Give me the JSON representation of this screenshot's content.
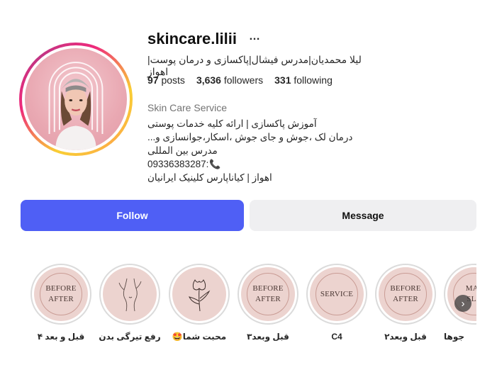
{
  "profile": {
    "username": "skincare.lilii",
    "more_icon": "…",
    "full_name": "لیلا محمدیان|مدرس فیشال|پاکسازی و درمان پوست|اهواز",
    "stats": {
      "posts_count": "97",
      "posts_label": "posts",
      "followers_count": "3,636",
      "followers_label": "followers",
      "following_count": "331",
      "following_label": "following"
    },
    "category": "Skin Care Service",
    "bio": {
      "line1": "آموزش پاکسازی | ارائه کلیه خدمات پوستی",
      "line2": "درمان لک ،جوش و جای جوش ،اسکار،جوانسازی و...",
      "line3": "مدرس بین المللی",
      "phone": "09336383287:",
      "phone_icon": "📞",
      "line5": "اهواز | کیاناپارس کلینیک ایرانیان"
    }
  },
  "actions": {
    "follow_label": "Follow",
    "message_label": "Message"
  },
  "highlights": [
    {
      "label": "قبل و بعد ۴",
      "text_line1": "BEFORE",
      "text_line2": "AFTER",
      "type": "text"
    },
    {
      "label": "رفع تیرگی بدن",
      "type": "body-sketch-icon"
    },
    {
      "label": "محبت شما🤩",
      "type": "flower-icon"
    },
    {
      "label": "قبل وبعد۳",
      "text_line1": "BEFORE",
      "text_line2": "AFTER",
      "type": "text"
    },
    {
      "label": "C4",
      "text_line1": "SERVICE",
      "text_line2": "",
      "type": "text"
    },
    {
      "label": "قبل وبعد۲",
      "text_line1": "BEFORE",
      "text_line2": "AFTER",
      "type": "text"
    },
    {
      "label": "جوها",
      "text_line1": "MAS",
      "text_line2": "SLA",
      "type": "text"
    }
  ],
  "next_arrow_icon": "›",
  "colors": {
    "follow_bg": "#4f5ff5",
    "message_bg": "#efeff1",
    "highlight_bg": "#ecd3cf"
  }
}
